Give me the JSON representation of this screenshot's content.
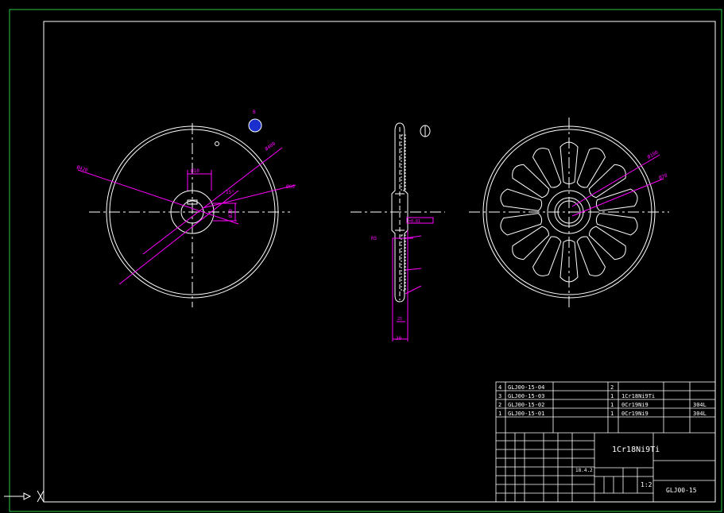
{
  "colors": {
    "background": "#000000",
    "outline": "#ffffff",
    "dimension": "#ff00ff",
    "sheet_border": "#2ecc40",
    "marker": "#1a2fcc"
  },
  "annotations": {
    "front_view": {
      "d_outer": "Ø420",
      "d_mid": "Ø400",
      "d_hub": "Ø60",
      "d_small": "Ø10",
      "hole": "Ø20",
      "angle": "15°"
    },
    "side_view": {
      "radius": "R5",
      "length": "30",
      "thickness": "25",
      "tolerance": "=0.01"
    },
    "rear_view": {
      "d_inner": "Ø100",
      "d_outer": "Ø70"
    },
    "marker_label": "B"
  },
  "title_block": {
    "parts": [
      {
        "no": "4",
        "code": "GLJ00-15-04",
        "name": "",
        "qty": "2",
        "material": "",
        "note": ""
      },
      {
        "no": "3",
        "code": "GLJ00-15-03",
        "name": "",
        "qty": "1",
        "material": "1Cr18Ni9Ti",
        "note": ""
      },
      {
        "no": "2",
        "code": "GLJ00-15-02",
        "name": "",
        "qty": "1",
        "material": "0Cr19Ni9",
        "note": "304L"
      },
      {
        "no": "1",
        "code": "GLJ00-15-01",
        "name": "",
        "qty": "1",
        "material": "0Cr19Ni9",
        "note": "304L"
      }
    ],
    "material_main": "1Cr18Ni9Ti",
    "date": "18.4.2",
    "scale": "1:2",
    "drawing_no": "GLJ00-15"
  }
}
